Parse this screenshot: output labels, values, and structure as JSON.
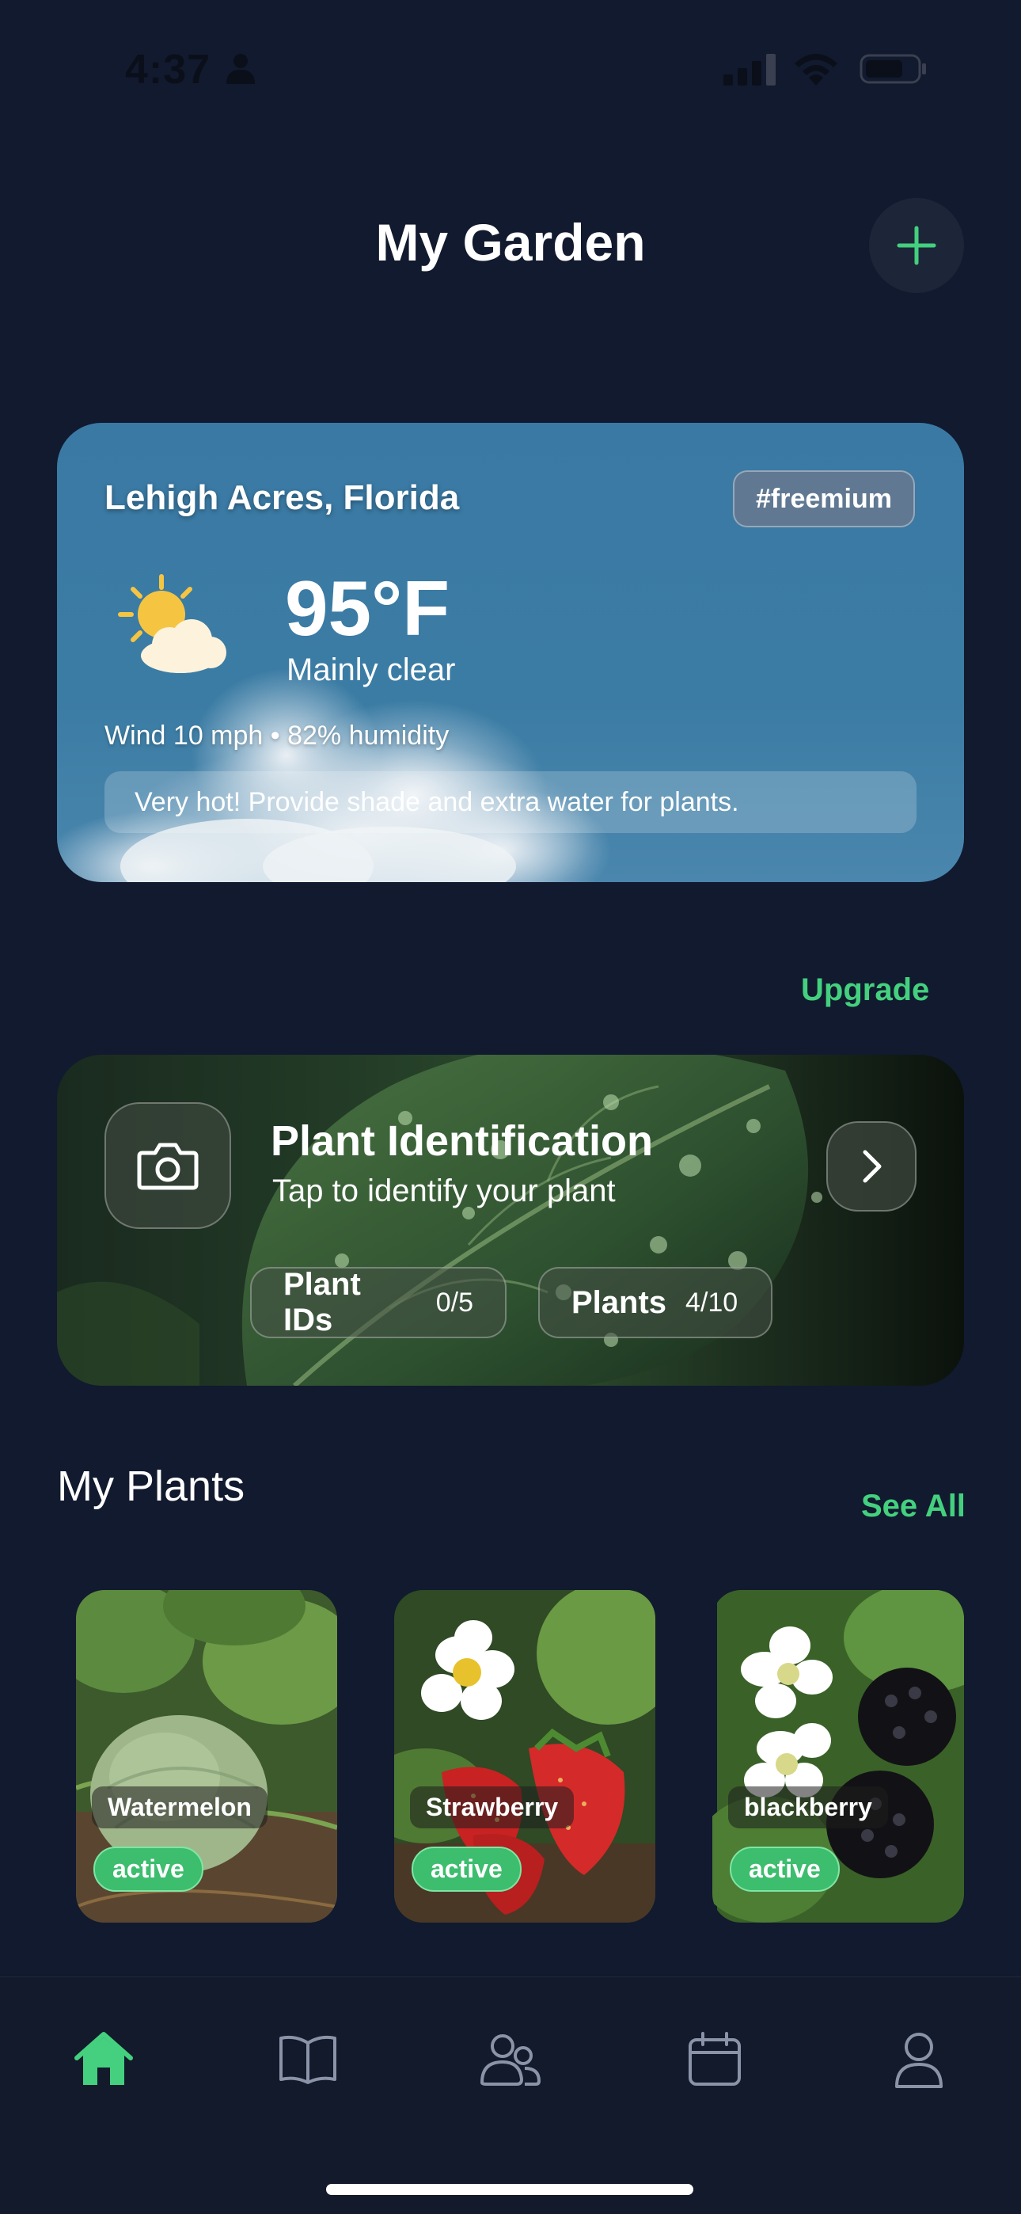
{
  "status_bar": {
    "time": "4:37"
  },
  "header": {
    "title": "My Garden"
  },
  "weather": {
    "location": "Lehigh Acres, Florida",
    "plan_badge": "#freemium",
    "temperature": "95°F",
    "condition": "Mainly clear",
    "details": "Wind 10 mph • 82% humidity",
    "advice": "Very hot! Provide shade and extra water for plants."
  },
  "upgrade_label": "Upgrade",
  "plant_identification": {
    "title": "Plant Identification",
    "subtitle": "Tap to identify your plant",
    "stats": [
      {
        "label": "Plant IDs",
        "value": "0/5"
      },
      {
        "label": "Plants",
        "value": "4/10"
      }
    ]
  },
  "my_plants": {
    "title": "My Plants",
    "see_all_label": "See All",
    "items": [
      {
        "name": "Watermelon",
        "status": "active"
      },
      {
        "name": "Strawberry",
        "status": "active"
      },
      {
        "name": "blackberry",
        "status": "active"
      }
    ]
  },
  "tab_bar": {
    "tabs": [
      {
        "icon": "home-icon",
        "active": true
      },
      {
        "icon": "book-icon",
        "active": false
      },
      {
        "icon": "community-icon",
        "active": false
      },
      {
        "icon": "calendar-icon",
        "active": false
      },
      {
        "icon": "profile-icon",
        "active": false
      }
    ]
  },
  "colors": {
    "background": "#111a2e",
    "accent": "#44d07e",
    "status_active": "#3dbd6e"
  }
}
